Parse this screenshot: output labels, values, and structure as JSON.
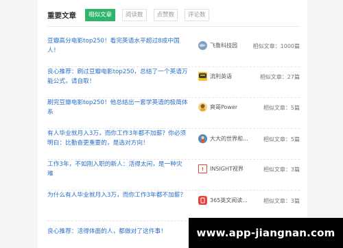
{
  "tabs": {
    "title": "重要文章",
    "items": [
      {
        "label": "相似文章",
        "active": true
      },
      {
        "label": "阅读数",
        "active": false
      },
      {
        "label": "点赞数",
        "active": false
      },
      {
        "label": "评论数",
        "active": false
      }
    ]
  },
  "articles": [
    {
      "title": "豆瓣高分电影top250！看完英语水平超过8成中国人！",
      "author": "飞鲁科技园",
      "count": "相似文章：1000篇",
      "avatar_icon": "globe-avatar",
      "avatar_color": "#8aa8c8"
    },
    {
      "title": "良心推荐：刷过豆瓣电影top250，总结了一个英语万能公式，请自取！",
      "author": "流利英语",
      "count": "相似文章：27篇",
      "avatar_icon": "chat-avatar",
      "avatar_color": "#f2c230"
    },
    {
      "title": "刷完豆瓣电影top250！他总结出一套学英语的极简体系",
      "author": "爽哥Power",
      "count": "相似文章：5篇",
      "avatar_icon": "person-avatar",
      "avatar_color": "#e8a33a"
    },
    {
      "title": "有人毕业就月入3万，而你工作3年都不加薪？你必须明白：比勤奋更重要的，是选对方向！",
      "author": "大大的世界和...",
      "count": "相似文章：5篇",
      "avatar_icon": "photo-avatar",
      "avatar_color": "#4a7aa8"
    },
    {
      "title": "工作3年，不如刚入职的新人：活得太闲，是一种灾难",
      "author": "INSIGHT视界",
      "count": "相似文章：3篇",
      "avatar_icon": "insight-avatar",
      "avatar_color": "#d94b3b"
    },
    {
      "title": "为什么有人毕业就月入3万，而你工作3年都不加薪？",
      "author": "365英文阅读...",
      "count": "相似文章：3篇",
      "avatar_icon": "book-avatar",
      "avatar_color": "#e2463a"
    },
    {
      "title": "良心推荐：活得体面的人，都做对了这件事！",
      "author": "",
      "count": "",
      "avatar_icon": "",
      "avatar_color": ""
    }
  ],
  "watermark": "www.app-jiangnan.com"
}
